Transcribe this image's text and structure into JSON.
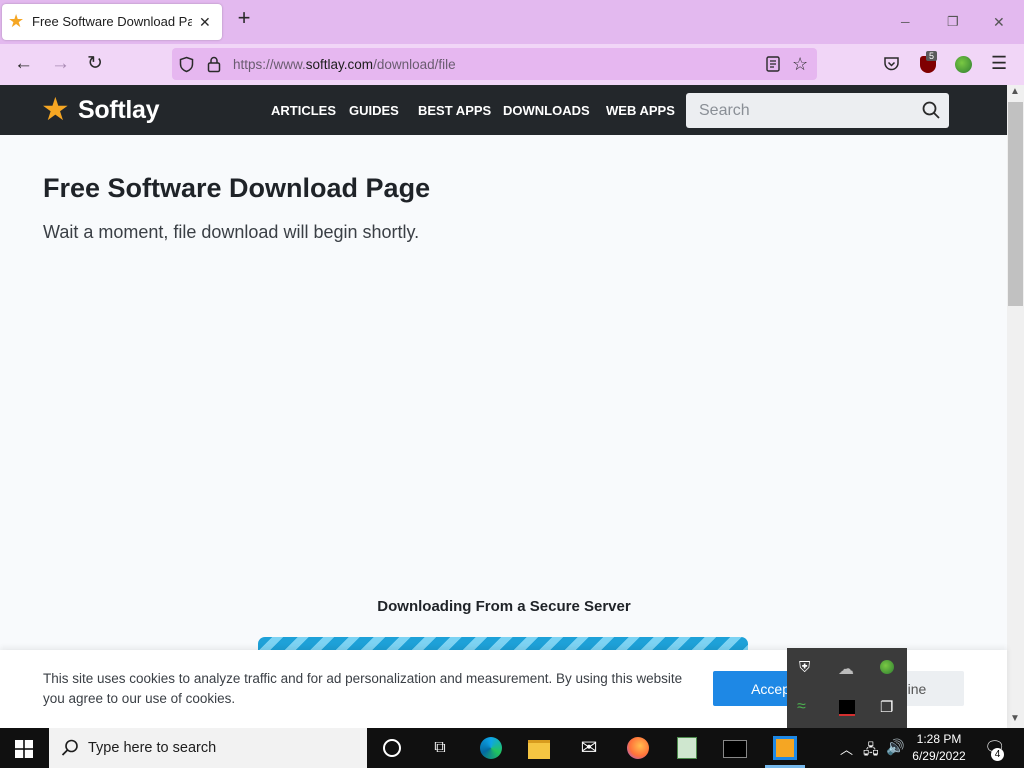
{
  "browser": {
    "tab_title": "Free Software Download Page - ",
    "tab_close": "✕",
    "new_tab": "+",
    "url_prefix": "https://www.",
    "url_domain": "softlay.com",
    "url_path": "/download/file",
    "ublock_badge": "5",
    "window_controls": {
      "minimize": "─",
      "restore": "❐",
      "close": "✕"
    },
    "icons": [
      "back-icon",
      "forward-icon",
      "reload-icon",
      "shield-icon",
      "lock-icon",
      "reader-icon",
      "bookmark-star-icon",
      "pocket-icon",
      "ublock-icon",
      "extension-globe-icon",
      "menu-icon"
    ]
  },
  "site": {
    "logo_text": "Softlay",
    "nav": [
      "ARTICLES",
      "GUIDES",
      "BEST APPS",
      "DOWNLOADS",
      "WEB APPS"
    ],
    "search_placeholder": "Search",
    "accent": "#f5a623"
  },
  "content": {
    "title": "Free Software Download Page",
    "subtitle": "Wait a moment, file download will begin shortly.",
    "secure_label": "Downloading From a Secure Server",
    "progress_color": "#1ea1d8"
  },
  "cookie": {
    "text": "This site uses cookies to analyze traffic and for ad personalization and measurement. By using this website you agree to our use of cookies.",
    "accept": "Accept",
    "decline": "Decline"
  },
  "taskbar": {
    "search_text": "Type here to search",
    "time": "1:28 PM",
    "date": "6/29/2022",
    "notifications": "4",
    "apps": [
      "cortana-icon",
      "task-view-icon",
      "edge-icon",
      "file-explorer-icon",
      "mail-icon",
      "firefox-icon",
      "notepad-icon",
      "terminal-icon",
      "virtualbox-icon"
    ]
  }
}
